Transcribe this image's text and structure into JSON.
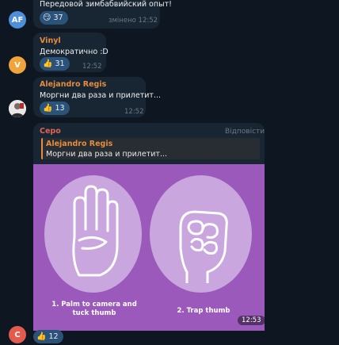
{
  "messages": [
    {
      "sender": "",
      "text": "Передовой зимбабвийский опыт!",
      "avatar_initials": "AF",
      "avatar_color": "#4e8fdc",
      "reaction": {
        "emoji": "😏",
        "count": "37"
      },
      "edited_label": "змінено",
      "time": "12:52"
    },
    {
      "sender": "Vinyl",
      "sender_color": "#e58d3c",
      "text": "Демократично :D",
      "avatar_initials": "V",
      "avatar_color": "#f0a43a",
      "reaction": {
        "emoji": "👍",
        "count": "31"
      },
      "time": "12:52"
    },
    {
      "sender": "Alejandro Regis",
      "sender_color": "#e58d3c",
      "text": "Моргни два раза и прилетит...",
      "reaction": {
        "emoji": "👍",
        "count": "13"
      },
      "time": "12:52"
    },
    {
      "sender": "Серо",
      "sender_color": "#e06452",
      "reply_label": "Відповісти",
      "quote": {
        "name": "Alejandro Regis",
        "text": "Моргни два раза и прилетит..."
      },
      "avatar_initials": "C",
      "avatar_color": "#e45b4d",
      "image": {
        "caption_left": "1. Palm to camera and tuck thumb",
        "caption_right": "2. Trap thumb",
        "bg_color": "#9a59bb"
      },
      "time": "12:53",
      "reaction": {
        "emoji": "👍",
        "count": "12"
      }
    }
  ]
}
